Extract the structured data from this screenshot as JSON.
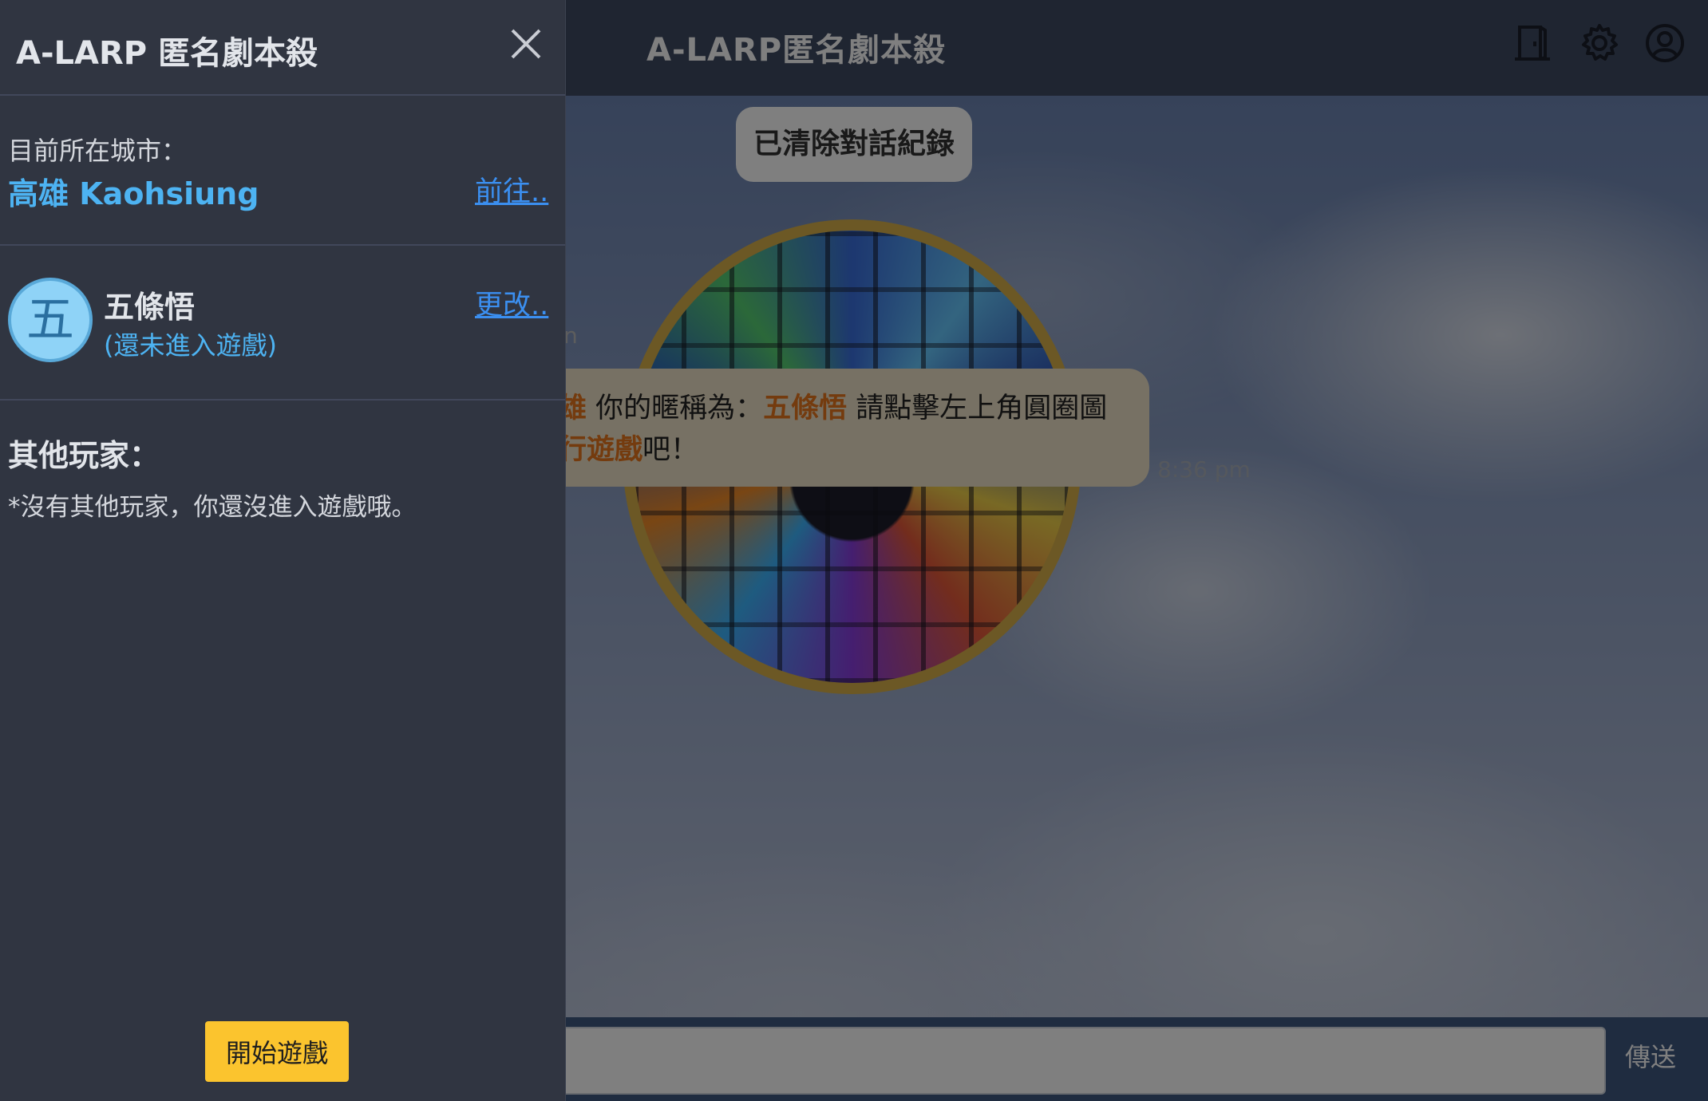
{
  "main": {
    "title": "A-LARP匿名劇本殺",
    "system_message": "已清除對話紀錄",
    "stub_letter": "n",
    "chat_message": {
      "line1_prefix": "雄",
      "line1_text": " 你的暱稱為：",
      "nickname": "五條悟",
      "line1_suffix": " 請點擊左上角圓圈圖",
      "line2_highlight": "行遊戲",
      "line2_suffix": "吧！"
    },
    "message_time": "8:36 pm",
    "send_label": "傳送",
    "header_icons": [
      "door-icon",
      "gear-icon",
      "account-icon"
    ]
  },
  "drawer": {
    "title": "A-LARP 匿名劇本殺",
    "city_label": "目前所在城市：",
    "city_name": "高雄 Kaohsiung",
    "goto_link": "前往..",
    "avatar_char": "五",
    "player_name": "五條悟",
    "player_status": "(還未進入遊戲)",
    "change_link": "更改..",
    "others_title": "其他玩家：",
    "others_empty": "*沒有其他玩家，你還沒進入遊戲哦。",
    "start_button": "開始遊戲"
  },
  "colors": {
    "drawer_bg": "#303541",
    "accent_blue": "#4db3f2",
    "link_blue": "#3b8ff0",
    "start_yellow": "#fbc42e",
    "highlight_orange": "#e8761c"
  }
}
